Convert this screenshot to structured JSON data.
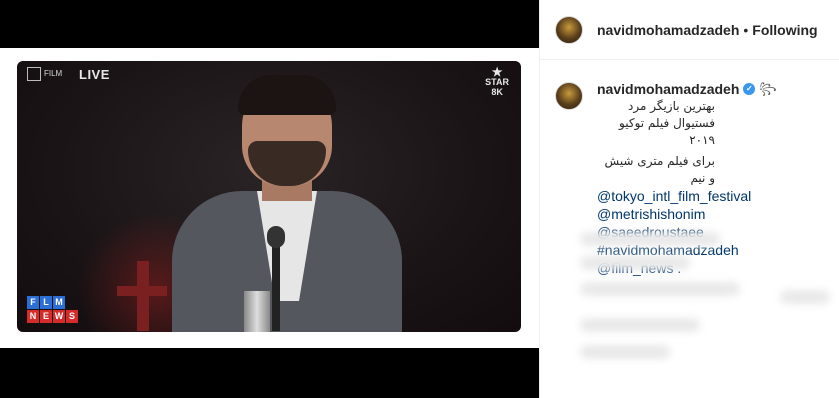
{
  "media": {
    "festival_logo_text": "FILM",
    "live_label": "LIVE",
    "star_label": "STAR",
    "star_sub": "8K",
    "overlay_film": [
      "F",
      "L",
      "M"
    ],
    "overlay_news": [
      "N",
      "E",
      "W",
      "S"
    ]
  },
  "header": {
    "username": "navidmohamadzadeh",
    "separator": "•",
    "follow_status": "Following"
  },
  "caption": {
    "username": "navidmohamadzadeh",
    "verified_mark": "✓",
    "ornament": "꧂",
    "lines_rtl": [
      "بهترین بازیگر مرد فستیوال فیلم توکیو",
      "۲۰۱۹",
      "برای فیلم متری شیش و نیم"
    ],
    "links": [
      "@tokyo_intl_film_festival",
      "@metrishishonim",
      "@saeedroustaee",
      "#navidmohamadzadeh",
      "@film_news ."
    ]
  },
  "colors": {
    "verified": "#3897f0",
    "link": "#00376b",
    "text": "#262626"
  }
}
